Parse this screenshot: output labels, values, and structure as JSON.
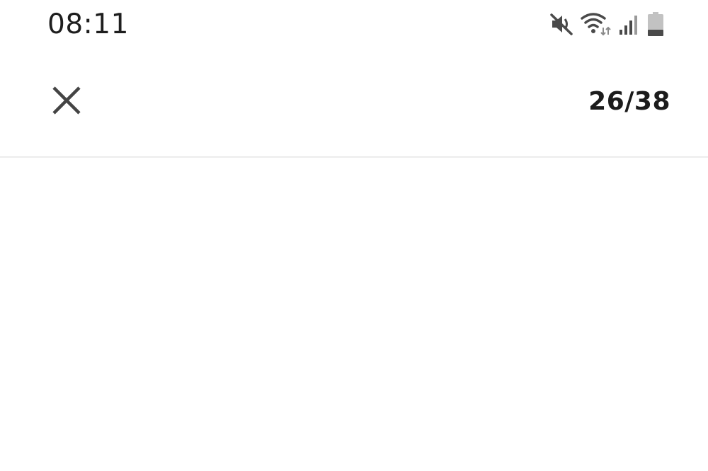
{
  "status_bar": {
    "time": "08:11",
    "icons": [
      "mute-icon",
      "wifi-icon",
      "signal-icon",
      "battery-icon"
    ]
  },
  "app_bar": {
    "close_icon": "close-icon",
    "page_counter": "26/38"
  },
  "colors": {
    "background": "#ffffff",
    "text": "#1c1c1c",
    "icon": "#4a4a4a",
    "divider": "#ececec"
  }
}
